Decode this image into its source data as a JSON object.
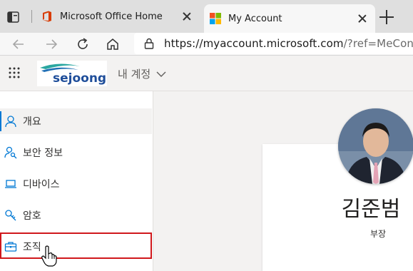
{
  "browser": {
    "tabs": [
      {
        "title": "Microsoft Office Home",
        "favicon": "office-icon",
        "active": false
      },
      {
        "title": "My Account",
        "favicon": "microsoft-icon",
        "active": true
      }
    ],
    "url_main": "https://myaccount.microsoft.com",
    "url_rest": "/?ref=MeContro"
  },
  "header": {
    "logo_text": "sejoong",
    "title": "내 계정"
  },
  "sidebar": {
    "items": [
      {
        "label": "개요",
        "icon": "person-icon",
        "selected": true
      },
      {
        "label": "보안 정보",
        "icon": "security-info-icon",
        "selected": false
      },
      {
        "label": "디바이스",
        "icon": "laptop-icon",
        "selected": false
      },
      {
        "label": "암호",
        "icon": "key-icon",
        "selected": false
      },
      {
        "label": "조직",
        "icon": "briefcase-icon",
        "selected": false,
        "highlighted": true
      }
    ]
  },
  "profile": {
    "name": "김준범",
    "job_title": "부장"
  },
  "colors": {
    "accent": "#0078d4",
    "highlight": "#d0181c"
  }
}
